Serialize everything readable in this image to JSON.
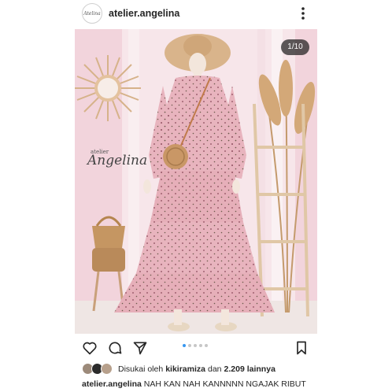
{
  "header": {
    "avatar_text": "Atelina",
    "username": "atelier.angelina"
  },
  "post": {
    "counter": "1/10",
    "brand_small": "atelier",
    "brand_big": "Angelina",
    "carousel_dots": 5,
    "active_dot": 0
  },
  "actions": {
    "like_icon": "heart-icon",
    "comment_icon": "comment-icon",
    "share_icon": "send-icon",
    "save_icon": "bookmark-icon"
  },
  "likes": {
    "prefix": "Disukai oleh",
    "user": "kikiramiza",
    "conj": "dan",
    "count": "2.209 lainnya"
  },
  "caption": {
    "username": "atelier.angelina",
    "text": "NAH KAN NAH KANNNNN NGAJAK RIBUT"
  },
  "colors": {
    "accent": "#3897f0",
    "background": "#f3d7dd",
    "dress": "#e8b4be"
  }
}
